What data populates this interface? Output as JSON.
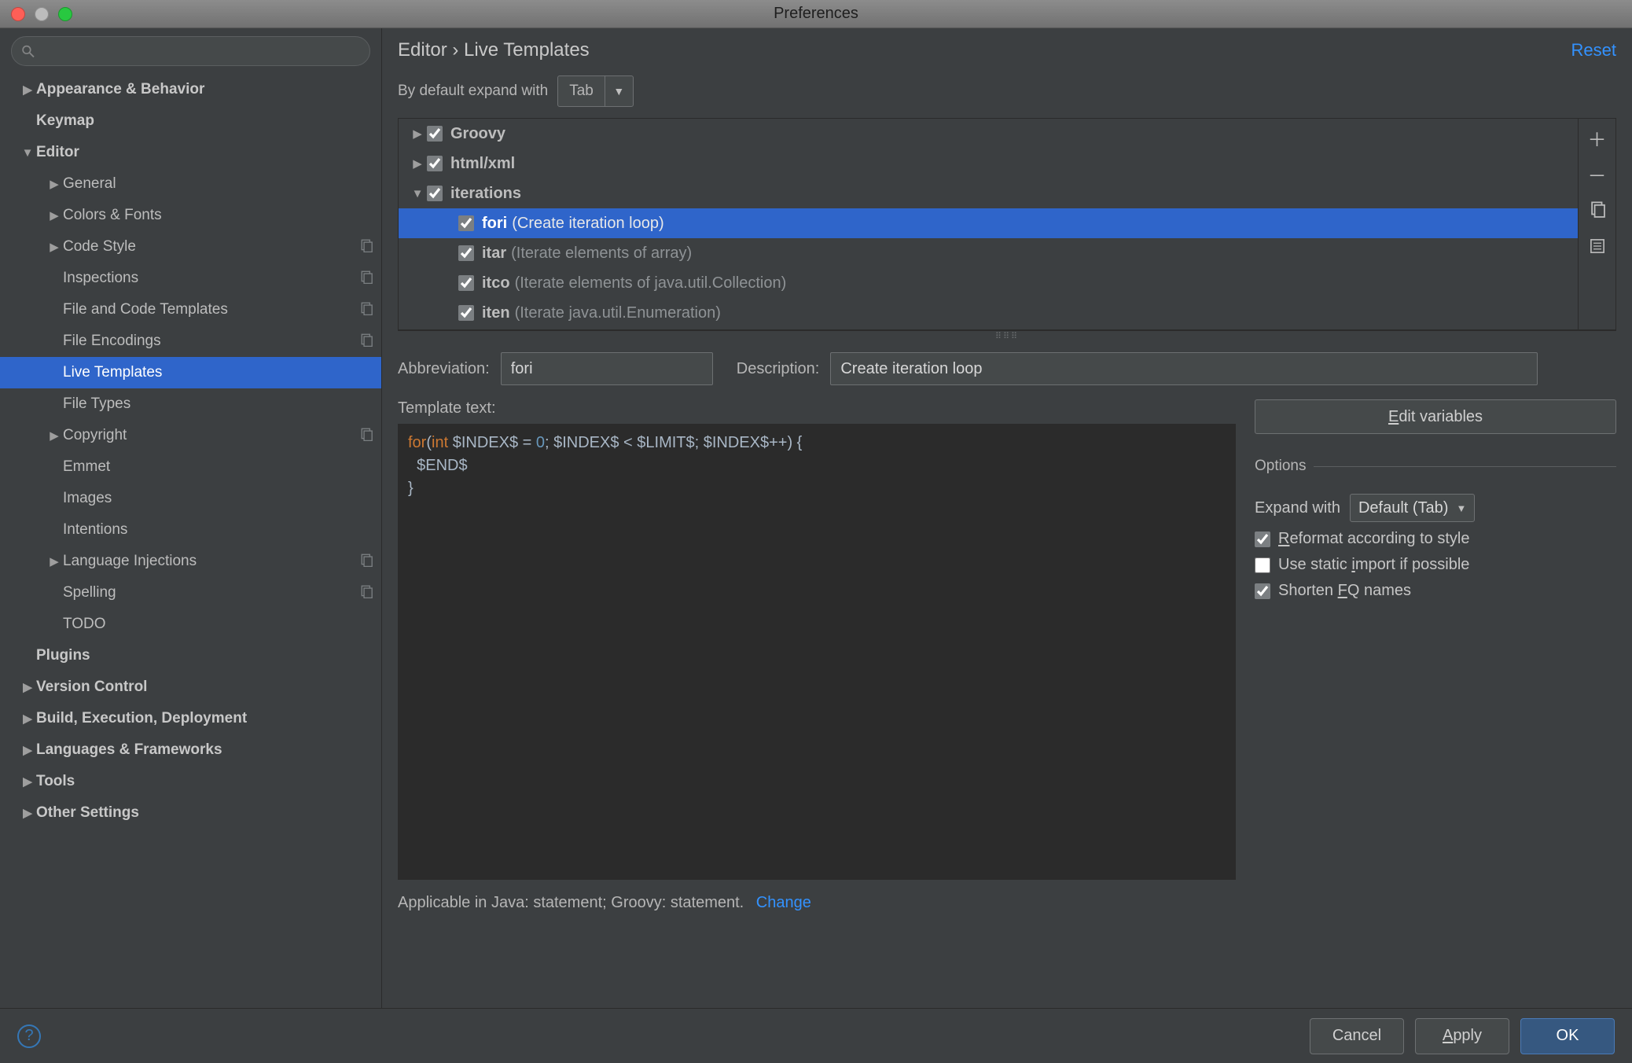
{
  "window": {
    "title": "Preferences"
  },
  "sidebar": {
    "search_placeholder": "",
    "items": [
      {
        "label": "Appearance & Behavior",
        "indent": 0,
        "expandable": true,
        "expanded": false,
        "bold": true
      },
      {
        "label": "Keymap",
        "indent": 0,
        "expandable": false,
        "bold": true
      },
      {
        "label": "Editor",
        "indent": 0,
        "expandable": true,
        "expanded": true,
        "bold": true
      },
      {
        "label": "General",
        "indent": 1,
        "expandable": true,
        "expanded": false
      },
      {
        "label": "Colors & Fonts",
        "indent": 1,
        "expandable": true,
        "expanded": false
      },
      {
        "label": "Code Style",
        "indent": 1,
        "expandable": true,
        "expanded": false,
        "icon": "project"
      },
      {
        "label": "Inspections",
        "indent": 1,
        "expandable": false,
        "icon": "project"
      },
      {
        "label": "File and Code Templates",
        "indent": 1,
        "expandable": false,
        "icon": "project"
      },
      {
        "label": "File Encodings",
        "indent": 1,
        "expandable": false,
        "icon": "project"
      },
      {
        "label": "Live Templates",
        "indent": 1,
        "expandable": false,
        "selected": true
      },
      {
        "label": "File Types",
        "indent": 1,
        "expandable": false
      },
      {
        "label": "Copyright",
        "indent": 1,
        "expandable": true,
        "expanded": false,
        "icon": "project"
      },
      {
        "label": "Emmet",
        "indent": 1,
        "expandable": false
      },
      {
        "label": "Images",
        "indent": 1,
        "expandable": false
      },
      {
        "label": "Intentions",
        "indent": 1,
        "expandable": false
      },
      {
        "label": "Language Injections",
        "indent": 1,
        "expandable": true,
        "expanded": false,
        "icon": "project"
      },
      {
        "label": "Spelling",
        "indent": 1,
        "expandable": false,
        "icon": "project"
      },
      {
        "label": "TODO",
        "indent": 1,
        "expandable": false
      },
      {
        "label": "Plugins",
        "indent": 0,
        "expandable": false,
        "bold": true
      },
      {
        "label": "Version Control",
        "indent": 0,
        "expandable": true,
        "expanded": false,
        "bold": true
      },
      {
        "label": "Build, Execution, Deployment",
        "indent": 0,
        "expandable": true,
        "expanded": false,
        "bold": true
      },
      {
        "label": "Languages & Frameworks",
        "indent": 0,
        "expandable": true,
        "expanded": false,
        "bold": true
      },
      {
        "label": "Tools",
        "indent": 0,
        "expandable": true,
        "expanded": false,
        "bold": true
      },
      {
        "label": "Other Settings",
        "indent": 0,
        "expandable": true,
        "expanded": false,
        "bold": true
      }
    ]
  },
  "content": {
    "breadcrumb": "Editor › Live Templates",
    "reset": "Reset",
    "default_expand_label": "By default expand with",
    "default_expand_value": "Tab",
    "templates": [
      {
        "indent": 0,
        "expandable": true,
        "expanded": false,
        "checked": true,
        "name": "Groovy"
      },
      {
        "indent": 0,
        "expandable": true,
        "expanded": false,
        "checked": true,
        "name": "html/xml"
      },
      {
        "indent": 0,
        "expandable": true,
        "expanded": true,
        "checked": true,
        "name": "iterations"
      },
      {
        "indent": 1,
        "expandable": false,
        "checked": true,
        "name": "fori",
        "desc": "(Create iteration loop)",
        "selected": true
      },
      {
        "indent": 1,
        "expandable": false,
        "checked": true,
        "name": "itar",
        "desc": "(Iterate elements of array)"
      },
      {
        "indent": 1,
        "expandable": false,
        "checked": true,
        "name": "itco",
        "desc": "(Iterate elements of java.util.Collection)"
      },
      {
        "indent": 1,
        "expandable": false,
        "checked": true,
        "name": "iten",
        "desc": "(Iterate java.util.Enumeration)"
      }
    ],
    "abbrev_label": "Abbreviation:",
    "abbrev_value": "fori",
    "desc_label": "Description:",
    "desc_value": "Create iteration loop",
    "template_text_label": "Template text:",
    "template_lines": {
      "l1a": "for",
      "l1b": "(",
      "l1c": "int",
      "l1d": " $INDEX$ = ",
      "l1e": "0",
      "l1f": "; $INDEX$ < $LIMIT$; $INDEX$++) {",
      "l2": "  $END$",
      "l3": "}"
    },
    "edit_vars_label": "Edit variables",
    "options": {
      "legend": "Options",
      "expand_label": "Expand with",
      "expand_value": "Default (Tab)",
      "reformat": {
        "checked": true,
        "label_pre": "R",
        "label_rest": "eformat according to style"
      },
      "static_import": {
        "checked": false,
        "label": "Use static ",
        "ul": "i",
        "label_rest": "mport if possible"
      },
      "shorten_fq": {
        "checked": true,
        "label": "Shorten ",
        "ul": "F",
        "label_rest": "Q names"
      }
    },
    "applicable_text": "Applicable in Java: statement; Groovy: statement.",
    "change_label": "Change"
  },
  "footer": {
    "cancel": "Cancel",
    "apply": "Apply",
    "ok": "OK"
  }
}
